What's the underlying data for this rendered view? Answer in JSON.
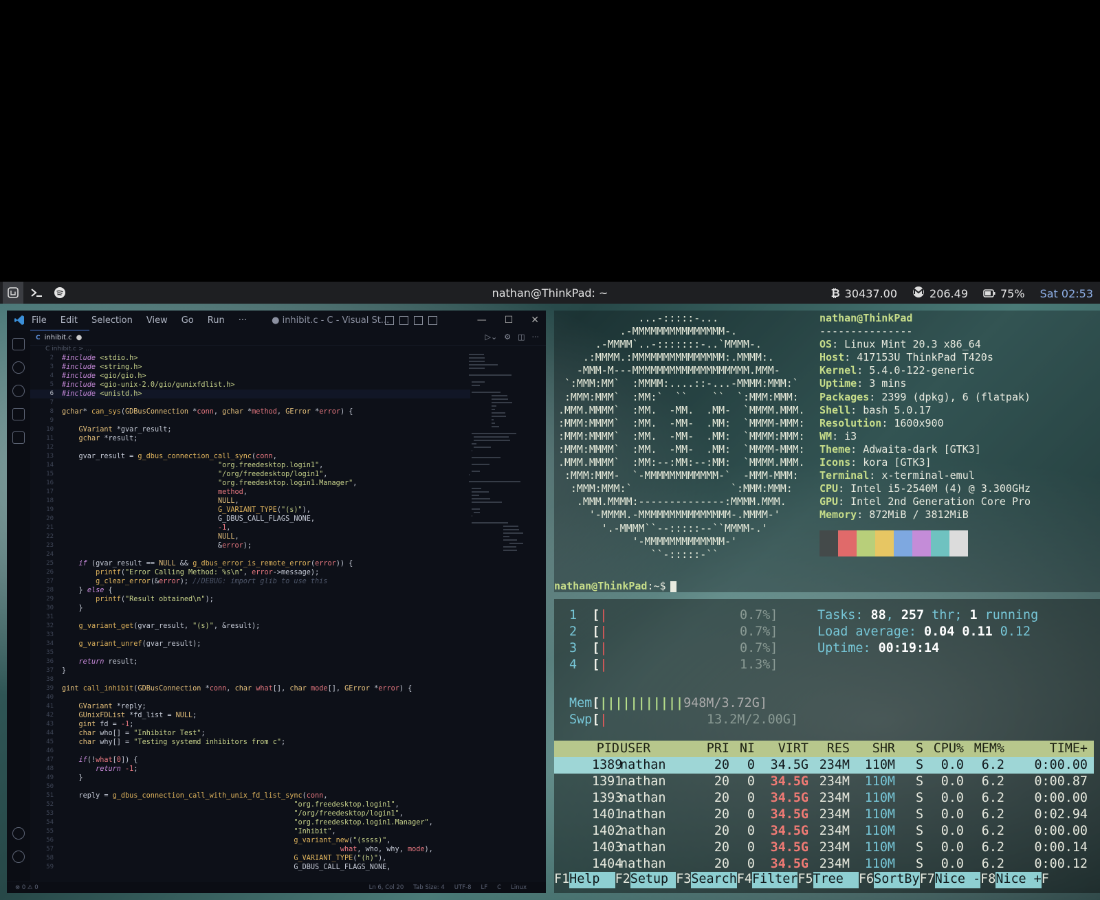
{
  "topbar": {
    "title": "nathan@ThinkPad: ~",
    "bitcoin": "30437.00",
    "monero": "206.49",
    "battery": "75%",
    "clock": "Sat 02:53"
  },
  "vscode": {
    "menu": [
      "File",
      "Edit",
      "Selection",
      "View",
      "Go",
      "Run",
      "···"
    ],
    "title": "● inhibit.c - C - Visual St...",
    "tab_label": "inhibit.c",
    "tab_lang": "C",
    "breadcrumb": "C inhibit.c > ...",
    "status_left": "⊗ 0 ⚠ 0",
    "status_right": [
      "Ln 6, Col 20",
      "Tab Size: 4",
      "UTF-8",
      "LF",
      "C",
      "Linux"
    ],
    "code": [
      {
        "n": "2",
        "t": "<span class='pp'>#include</span> <span class='st'>&lt;stdio.h&gt;</span>"
      },
      {
        "n": "3",
        "t": "<span class='pp'>#include</span> <span class='st'>&lt;string.h&gt;</span>"
      },
      {
        "n": "4",
        "t": "<span class='pp'>#include</span> <span class='st'>&lt;gio/gio.h&gt;</span>"
      },
      {
        "n": "5",
        "t": "<span class='pp'>#include</span> <span class='st'>&lt;gio-unix-2.0/gio/gunixfdlist.h&gt;</span>"
      },
      {
        "n": "6",
        "t": "<span class='pp'>#include</span> <span class='st'>&lt;unistd.h&gt;</span>",
        "cur": true
      },
      {
        "n": "7",
        "t": ""
      },
      {
        "n": "8",
        "t": "<span class='ty'>gchar</span>* <span class='fn'>can_sys</span>(<span class='ty'>GDBusConnection</span> *<span class='pa'>conn</span>, <span class='ty'>gchar</span> *<span class='pa'>method</span>, <span class='ty'>GError</span> *<span class='pa'>error</span>) {"
      },
      {
        "n": "9",
        "t": ""
      },
      {
        "n": "10",
        "t": "    <span class='ty'>GVariant</span> *gvar_result;"
      },
      {
        "n": "11",
        "t": "    <span class='ty'>gchar</span> *result;"
      },
      {
        "n": "12",
        "t": ""
      },
      {
        "n": "13",
        "t": "    gvar_result = <span class='fn'>g_dbus_connection_call_sync</span>(<span class='pa'>conn</span>,"
      },
      {
        "n": "14",
        "t": "                                     <span class='st'>\"org.freedesktop.login1\"</span>,"
      },
      {
        "n": "15",
        "t": "                                     <span class='st'>\"/org/freedesktop/login1\"</span>,"
      },
      {
        "n": "16",
        "t": "                                     <span class='st'>\"org.freedesktop.login1.Manager\"</span>,"
      },
      {
        "n": "17",
        "t": "                                     <span class='pa'>method</span>,"
      },
      {
        "n": "18",
        "t": "                                     <span class='ty'>NULL</span>,"
      },
      {
        "n": "19",
        "t": "                                     <span class='fn'>G_VARIANT_TYPE</span>(<span class='st'>\"(s)\"</span>),"
      },
      {
        "n": "20",
        "t": "                                     G_DBUS_CALL_FLAGS_NONE,"
      },
      {
        "n": "21",
        "t": "                                     <span class='pa'>-1</span>,"
      },
      {
        "n": "22",
        "t": "                                     <span class='ty'>NULL</span>,"
      },
      {
        "n": "23",
        "t": "                                     &amp;<span class='pa'>error</span>);"
      },
      {
        "n": "24",
        "t": ""
      },
      {
        "n": "25",
        "t": "    <span class='kw'>if</span> (gvar_result == <span class='ty'>NULL</span> &amp;&amp; <span class='fn'>g_dbus_error_is_remote_error</span>(<span class='pa'>error</span>)) {"
      },
      {
        "n": "26",
        "t": "        <span class='fn'>printf</span>(<span class='st'>\"Error Calling Method: %s\\n\"</span>, <span class='pa'>error</span>-&gt;message);"
      },
      {
        "n": "27",
        "t": "        <span class='fn'>g_clear_error</span>(&amp;<span class='pa'>error</span>); <span class='cm'>//DEBUG: import glib to use this</span>"
      },
      {
        "n": "28",
        "t": "    } <span class='kw'>else</span> {"
      },
      {
        "n": "29",
        "t": "        <span class='fn'>printf</span>(<span class='st'>\"Result obtained\\n\"</span>);"
      },
      {
        "n": "30",
        "t": "    }"
      },
      {
        "n": "31",
        "t": ""
      },
      {
        "n": "32",
        "t": "    <span class='fn'>g_variant_get</span>(gvar_result, <span class='st'>\"(s)\"</span>, &amp;result);"
      },
      {
        "n": "33",
        "t": ""
      },
      {
        "n": "34",
        "t": "    <span class='fn'>g_variant_unref</span>(gvar_result);"
      },
      {
        "n": "35",
        "t": ""
      },
      {
        "n": "36",
        "t": "    <span class='kw'>return</span> result;"
      },
      {
        "n": "37",
        "t": "}"
      },
      {
        "n": "38",
        "t": ""
      },
      {
        "n": "39",
        "t": "<span class='ty'>gint</span> <span class='fn'>call_inhibit</span>(<span class='ty'>GDBusConnection</span> *<span class='pa'>conn</span>, <span class='ty'>char</span> <span class='pa'>what</span>[], <span class='ty'>char</span> <span class='pa'>mode</span>[], <span class='ty'>GError</span> *<span class='pa'>error</span>) {"
      },
      {
        "n": "40",
        "t": ""
      },
      {
        "n": "41",
        "t": "    <span class='ty'>GVariant</span> *reply;"
      },
      {
        "n": "42",
        "t": "    <span class='ty'>GUnixFDList</span> *fd_list = <span class='ty'>NULL</span>;"
      },
      {
        "n": "43",
        "t": "    <span class='ty'>gint</span> fd = <span class='pa'>-1</span>;"
      },
      {
        "n": "44",
        "t": "    <span class='ty'>char</span> who[] = <span class='st'>\"Inhibitor Test\"</span>;"
      },
      {
        "n": "45",
        "t": "    <span class='ty'>char</span> why[] = <span class='st'>\"Testing systemd inhibitors from c\"</span>;"
      },
      {
        "n": "46",
        "t": ""
      },
      {
        "n": "47",
        "t": "    <span class='kw'>if</span>(!<span class='pa'>what</span>[<span class='pa'>0</span>]) {"
      },
      {
        "n": "48",
        "t": "        <span class='kw'>return</span> <span class='pa'>-1</span>;"
      },
      {
        "n": "49",
        "t": "    }"
      },
      {
        "n": "50",
        "t": ""
      },
      {
        "n": "51",
        "t": "    reply = <span class='fn'>g_dbus_connection_call_with_unix_fd_list_sync</span>(<span class='pa'>conn</span>,"
      },
      {
        "n": "52",
        "t": "                                                       <span class='st'>\"org.freedesktop.login1\"</span>,"
      },
      {
        "n": "53",
        "t": "                                                       <span class='st'>\"/org/freedesktop/login1\"</span>,"
      },
      {
        "n": "54",
        "t": "                                                       <span class='st'>\"org.freedesktop.login1.Manager\"</span>,"
      },
      {
        "n": "55",
        "t": "                                                       <span class='st'>\"Inhibit\"</span>,"
      },
      {
        "n": "56",
        "t": "                                                       <span class='fn'>g_variant_new</span>(<span class='st'>\"(ssss)\"</span>,"
      },
      {
        "n": "57",
        "t": "                                                                  <span class='pa'>what</span>, who, why, <span class='pa'>mode</span>),"
      },
      {
        "n": "58",
        "t": "                                                       <span class='fn'>G_VARIANT_TYPE</span>(<span class='st'>\"(h)\"</span>),"
      },
      {
        "n": "59",
        "t": "                                                       G_DBUS_CALL_FLAGS_NONE,"
      }
    ]
  },
  "neofetch": {
    "ascii": [
      "             ...-:::::-...",
      "          .-MMMMMMMMMMMMMMM-.",
      "      .-MMMM`..-:::::::-..`MMMM-.",
      "    .:MMMM.:MMMMMMMMMMMMMMM:.MMMM:.",
      "   -MMM-M---MMMMMMMMMMMMMMMMMMM.MMM-",
      " `:MMM:MM`  :MMMM:....::-...-MMMM:MMM:`",
      " :MMM:MMM`  :MM:`  ``    ``  `:MMM:MMM:",
      ".MMM.MMMM`  :MM.  -MM.  .MM-  `MMMM.MMM.",
      ":MMM:MMMM`  :MM.  -MM-  .MM:  `MMMM-MMM:",
      ":MMM:MMMM`  :MM.  -MM-  .MM:  `MMMM:MMM:",
      ":MMM:MMMM`  :MM.  -MM-  .MM:  `MMMM-MMM:",
      ".MMM.MMMM`  :MM:--:MM:--:MM:  `MMMM.MMM.",
      " :MMM:MMM-  `-MMMMMMMMMMMM-`  -MMM-MMM:",
      "  :MMM:MMM:`                `:MMM:MMM:",
      "   .MMM.MMMM:--------------:MMMM.MMM.",
      "     '-MMMM.-MMMMMMMMMMMMMMM-.MMMM-'",
      "       '.-MMMM``--:::::--``MMMM-.'",
      "            '-MMMMMMMMMMMMM-'",
      "               ``-:::::-``"
    ],
    "user": "nathan@ThinkPad",
    "sep": "---------------",
    "info": [
      {
        "k": "OS",
        "v": "Linux Mint 20.3 x86_64"
      },
      {
        "k": "Host",
        "v": "417153U ThinkPad T420s"
      },
      {
        "k": "Kernel",
        "v": "5.4.0-122-generic"
      },
      {
        "k": "Uptime",
        "v": "3 mins"
      },
      {
        "k": "Packages",
        "v": "2399 (dpkg), 6 (flatpak)"
      },
      {
        "k": "Shell",
        "v": "bash 5.0.17"
      },
      {
        "k": "Resolution",
        "v": "1600x900"
      },
      {
        "k": "WM",
        "v": "i3"
      },
      {
        "k": "Theme",
        "v": "Adwaita-dark [GTK3]"
      },
      {
        "k": "Icons",
        "v": "kora [GTK3]"
      },
      {
        "k": "Terminal",
        "v": "x-terminal-emul"
      },
      {
        "k": "CPU",
        "v": "Intel i5-2540M (4) @ 3.300GHz"
      },
      {
        "k": "GPU",
        "v": "Intel 2nd Generation Core Pro"
      },
      {
        "k": "Memory",
        "v": "872MiB / 3812MiB"
      }
    ],
    "palette": [
      "#444a4a",
      "#e06a6a",
      "#b8cf7a",
      "#e7c663",
      "#7ea8e0",
      "#c48cd8",
      "#6fc2c0",
      "#dcdcdc"
    ],
    "prompt_user": "nathan@ThinkPad",
    "prompt_rest": ":~$"
  },
  "htop": {
    "cpus": [
      {
        "id": "1",
        "pct": "0.7%]"
      },
      {
        "id": "2",
        "pct": "0.7%]"
      },
      {
        "id": "3",
        "pct": "0.7%]"
      },
      {
        "id": "4",
        "pct": "1.3%]"
      }
    ],
    "mem_label": "Mem",
    "mem_bar": "|||||||||||",
    "mem_val": "948M/3.72G]",
    "swp_label": "Swp",
    "swp_val": "13.2M/2.00G]",
    "tasks_label": "Tasks: ",
    "tasks": "88",
    "thr": "257",
    "thr_label": " thr; ",
    "running": "1",
    "running_label": " running",
    "load_label": "Load average: ",
    "load1": "0.04",
    "load5": "0.11",
    "load15": "0.12",
    "uptime_label": "Uptime: ",
    "uptime": "00:19:14",
    "columns": [
      "PID",
      "USER",
      "PRI",
      "NI",
      "VIRT",
      "RES",
      "SHR",
      "S",
      "CPU%",
      "MEM%",
      "TIME+"
    ],
    "processes": [
      {
        "pid": "1389",
        "user": "nathan",
        "pri": "20",
        "ni": "0",
        "virt": "34.5G",
        "res": "234M",
        "shr": "110M",
        "s": "S",
        "cpu": "0.0",
        "mem": "6.2",
        "time": "0:00.00"
      },
      {
        "pid": "1391",
        "user": "nathan",
        "pri": "20",
        "ni": "0",
        "virt": "34.5G",
        "res": "234M",
        "shr": "110M",
        "s": "S",
        "cpu": "0.0",
        "mem": "6.2",
        "time": "0:00.87"
      },
      {
        "pid": "1393",
        "user": "nathan",
        "pri": "20",
        "ni": "0",
        "virt": "34.5G",
        "res": "234M",
        "shr": "110M",
        "s": "S",
        "cpu": "0.0",
        "mem": "6.2",
        "time": "0:00.00"
      },
      {
        "pid": "1401",
        "user": "nathan",
        "pri": "20",
        "ni": "0",
        "virt": "34.5G",
        "res": "234M",
        "shr": "110M",
        "s": "S",
        "cpu": "0.0",
        "mem": "6.2",
        "time": "0:02.94"
      },
      {
        "pid": "1402",
        "user": "nathan",
        "pri": "20",
        "ni": "0",
        "virt": "34.5G",
        "res": "234M",
        "shr": "110M",
        "s": "S",
        "cpu": "0.0",
        "mem": "6.2",
        "time": "0:00.00"
      },
      {
        "pid": "1403",
        "user": "nathan",
        "pri": "20",
        "ni": "0",
        "virt": "34.5G",
        "res": "234M",
        "shr": "110M",
        "s": "S",
        "cpu": "0.0",
        "mem": "6.2",
        "time": "0:00.14"
      },
      {
        "pid": "1404",
        "user": "nathan",
        "pri": "20",
        "ni": "0",
        "virt": "34.5G",
        "res": "234M",
        "shr": "110M",
        "s": "S",
        "cpu": "0.0",
        "mem": "6.2",
        "time": "0:00.12"
      }
    ],
    "fkeys": [
      {
        "k": "F1",
        "l": "Help  "
      },
      {
        "k": "F2",
        "l": "Setup "
      },
      {
        "k": "F3",
        "l": "Search"
      },
      {
        "k": "F4",
        "l": "Filter"
      },
      {
        "k": "F5",
        "l": "Tree  "
      },
      {
        "k": "F6",
        "l": "SortBy"
      },
      {
        "k": "F7",
        "l": "Nice -"
      },
      {
        "k": "F8",
        "l": "Nice +"
      },
      {
        "k": "F",
        "l": ""
      }
    ]
  }
}
